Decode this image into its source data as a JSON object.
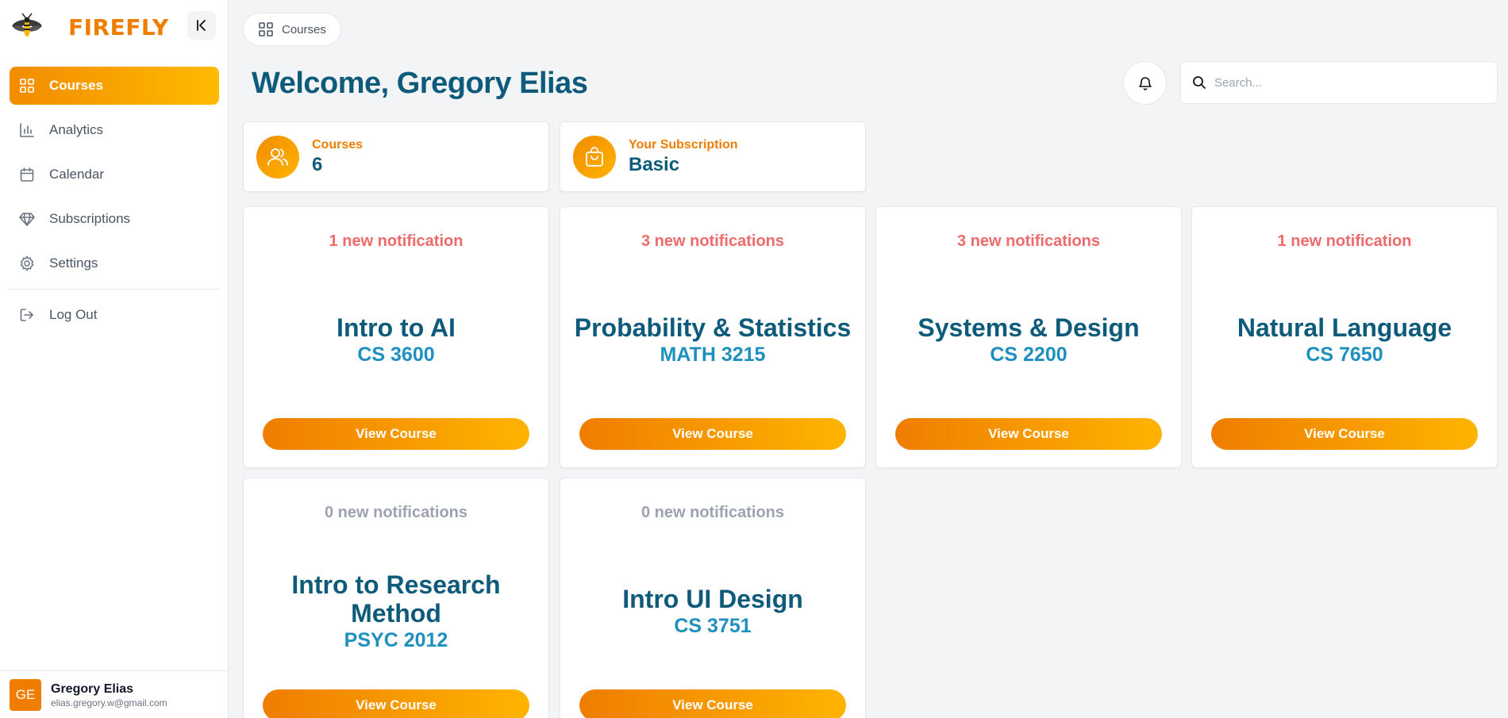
{
  "sidebar": {
    "brand": "FIREFLY",
    "items": [
      {
        "label": "Courses",
        "icon": "grid-icon",
        "active": true
      },
      {
        "label": "Analytics",
        "icon": "bar-chart-icon"
      },
      {
        "label": "Calendar",
        "icon": "calendar-icon"
      },
      {
        "label": "Subscriptions",
        "icon": "gem-icon"
      },
      {
        "label": "Settings",
        "icon": "gear-icon"
      }
    ],
    "logout": {
      "label": "Log Out",
      "icon": "logout-icon"
    },
    "user": {
      "initials": "GE",
      "name": "Gregory Elias",
      "email": "elias.gregory.w@gmail.com"
    }
  },
  "header": {
    "breadcrumb": "Courses",
    "welcome": "Welcome, Gregory Elias",
    "search_placeholder": "Search..."
  },
  "stats": [
    {
      "label": "Courses",
      "value": "6",
      "icon": "users-icon"
    },
    {
      "label": "Your Subscription",
      "value": "Basic",
      "icon": "shopping-bag-icon"
    }
  ],
  "courses": [
    {
      "notifications": "1 new notification",
      "title": "Intro to AI",
      "code": "CS 3600",
      "button": "View Course"
    },
    {
      "notifications": "3 new notifications",
      "title": "Probability & Statistics",
      "code": "MATH 3215",
      "button": "View Course"
    },
    {
      "notifications": "3 new notifications",
      "title": "Systems & Design",
      "code": "CS 2200",
      "button": "View Course"
    },
    {
      "notifications": "1 new notification",
      "title": "Natural Language",
      "code": "CS 7650",
      "button": "View Course"
    },
    {
      "notifications": "0 new notifications",
      "title": "Intro to Research Method",
      "code": "PSYC 2012",
      "button": "View Course"
    },
    {
      "notifications": "0 new notifications",
      "title": "Intro UI Design",
      "code": "CS 3751",
      "button": "View Course"
    }
  ],
  "colors": {
    "accent": "#ef7d00",
    "accent_light": "#ffb400",
    "heading": "#0e5a7a",
    "code": "#1e90c0",
    "notification": "#ef6a6a",
    "muted": "#9ca3af"
  }
}
